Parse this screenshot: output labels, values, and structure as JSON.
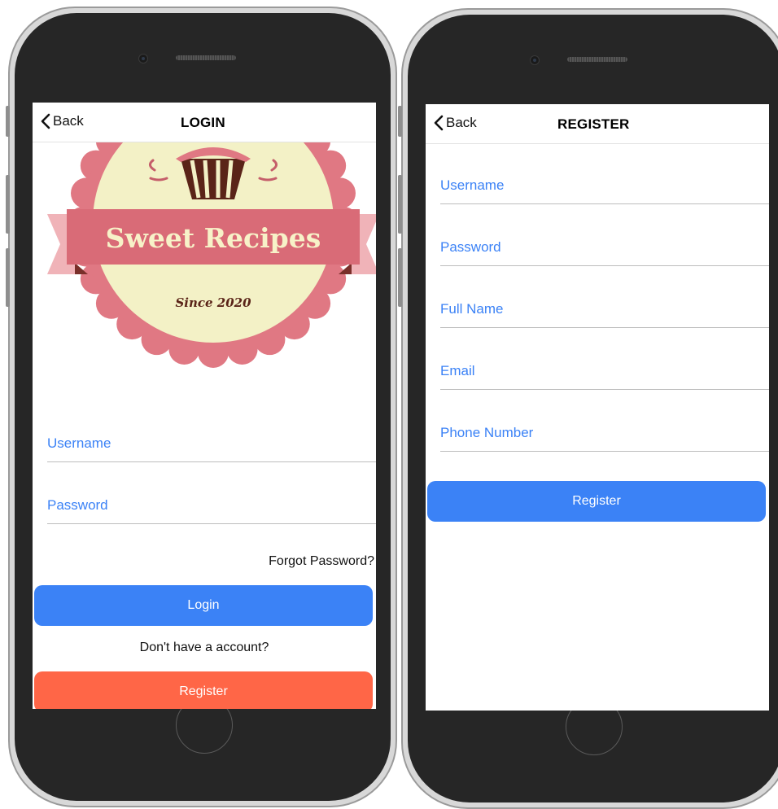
{
  "login": {
    "back_label": "Back",
    "title": "LOGIN",
    "logo": {
      "brand": "Sweet Recipes",
      "tagline": "Since 2020",
      "colors": {
        "badge": "#e07883",
        "inner": "#f3f1c6",
        "ribbon": "#d96b77",
        "ribbon_tail": "#f0b3b8",
        "cupcake": "#5a2418",
        "text": "#f7f2c8"
      }
    },
    "username_placeholder": "Username",
    "password_placeholder": "Password",
    "forgot_label": "Forgot Password?",
    "login_button": "Login",
    "no_account_text": "Don't have a account?",
    "register_button": "Register"
  },
  "register": {
    "back_label": "Back",
    "title": "REGISTER",
    "fields": [
      "Username",
      "Password",
      "Full Name",
      "Email",
      "Phone Number"
    ],
    "register_button": "Register"
  },
  "colors": {
    "accent_blue": "#3b82f6",
    "button_orange": "#ff6647",
    "phone_body": "#262626"
  }
}
